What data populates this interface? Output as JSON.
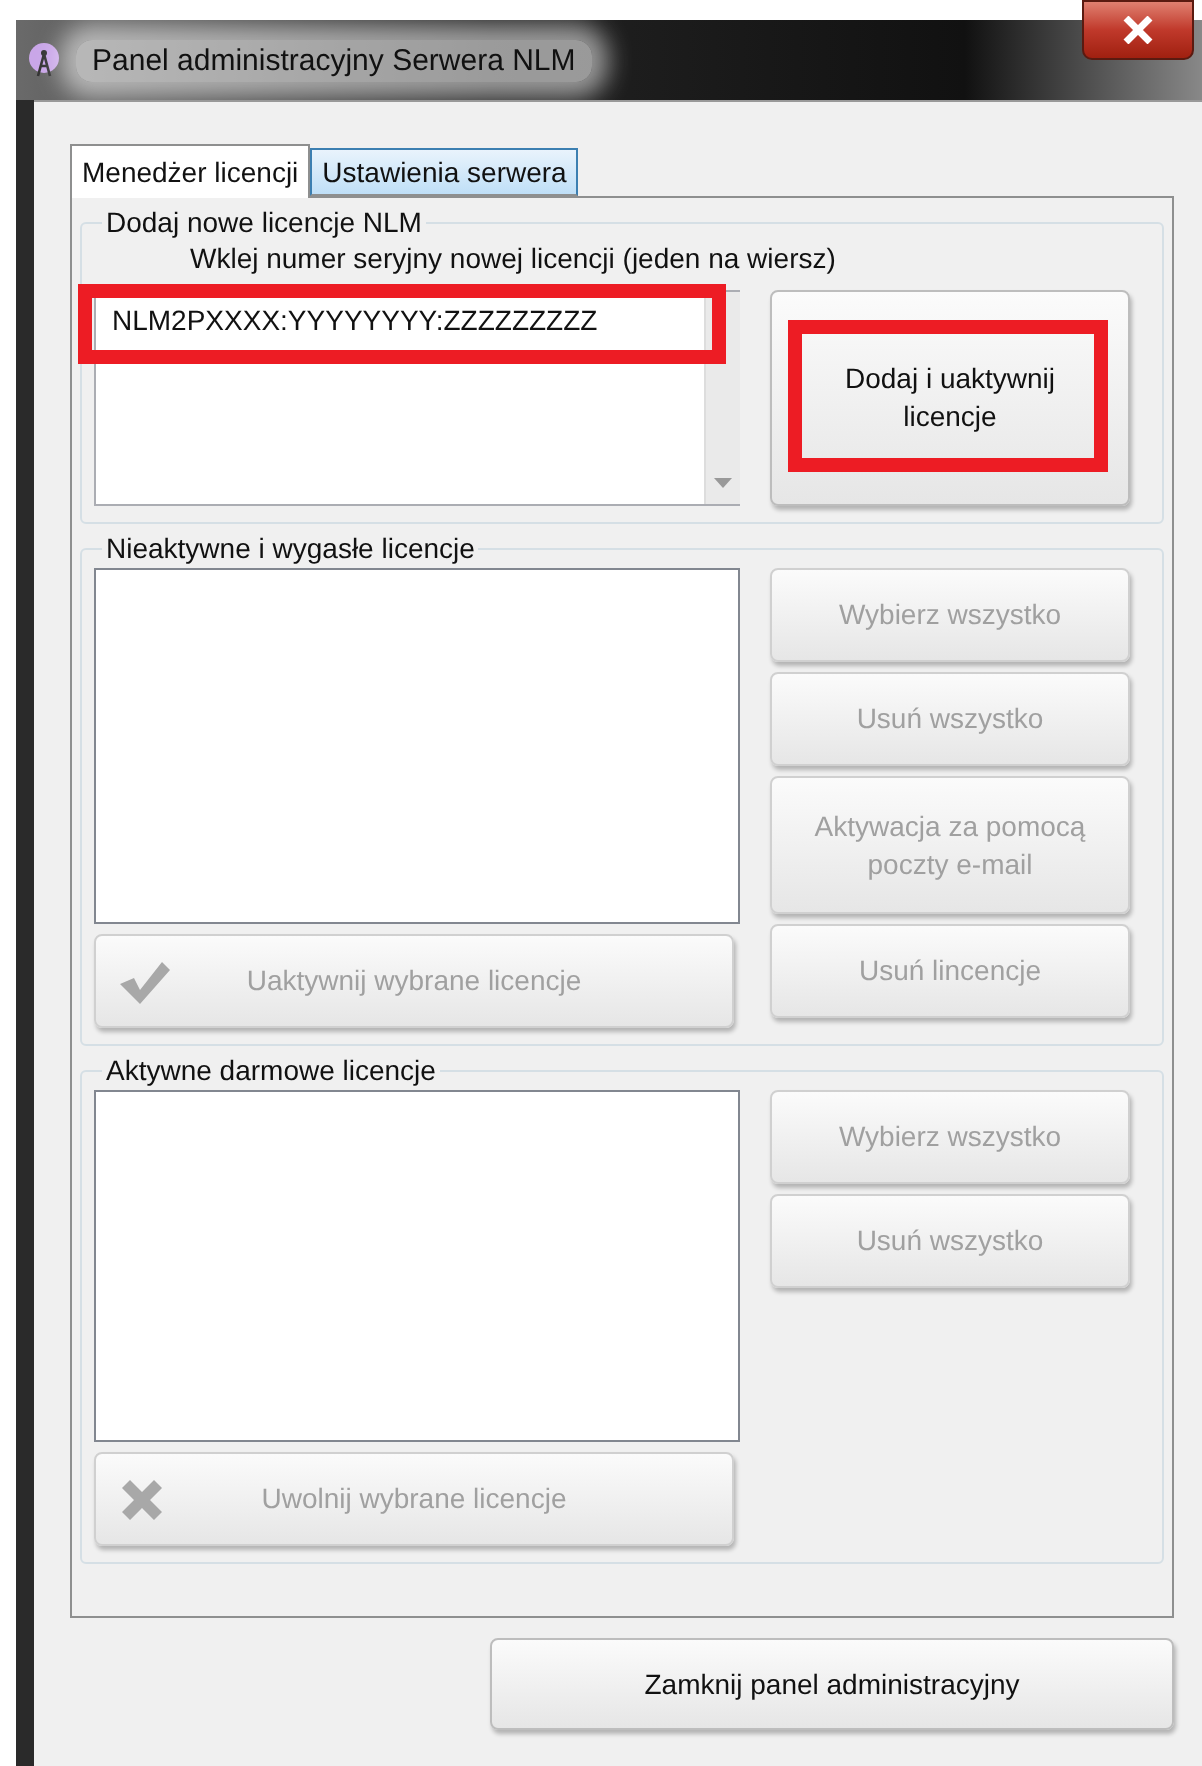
{
  "window": {
    "title": "Panel administracyjny Serwera NLM"
  },
  "tabs": [
    {
      "label": "Menedżer licencji",
      "selected": true
    },
    {
      "label": "Ustawienia serwera",
      "selected": false
    }
  ],
  "add_group": {
    "title": "Dodaj nowe licencje NLM",
    "hint": "Wklej numer seryjny nowej licencji (jeden na wiersz)",
    "serial_field": {
      "value": "NLM2PXXXX:YYYYYYYY:ZZZZZZZZZ",
      "highlighted": true
    },
    "add_button": {
      "label": "Dodaj i uaktywnij licencje",
      "disabled": false,
      "highlighted": true
    }
  },
  "inactive_group": {
    "title": "Nieaktywne i wygasłe licencje",
    "side_buttons": [
      {
        "label": "Wybierz wszystko",
        "disabled": true
      },
      {
        "label": "Usuń wszystko",
        "disabled": true
      },
      {
        "label": "Aktywacja za pomocą poczty e-mail",
        "disabled": true
      },
      {
        "label": "Usuń lincencje",
        "disabled": true
      }
    ],
    "bottom_button": {
      "label": "Uaktywnij wybrane licencje",
      "disabled": true,
      "kind": "check"
    }
  },
  "free_group": {
    "title": "Aktywne darmowe licencje",
    "side_buttons": [
      {
        "label": "Wybierz wszystko",
        "disabled": true
      },
      {
        "label": "Usuń wszystko",
        "disabled": true
      }
    ],
    "bottom_button": {
      "label": "Uwolnij wybrane licencje",
      "disabled": true,
      "kind": "cross"
    }
  },
  "close_button": {
    "label": "Zamknij panel administracyjny",
    "disabled": false
  }
}
